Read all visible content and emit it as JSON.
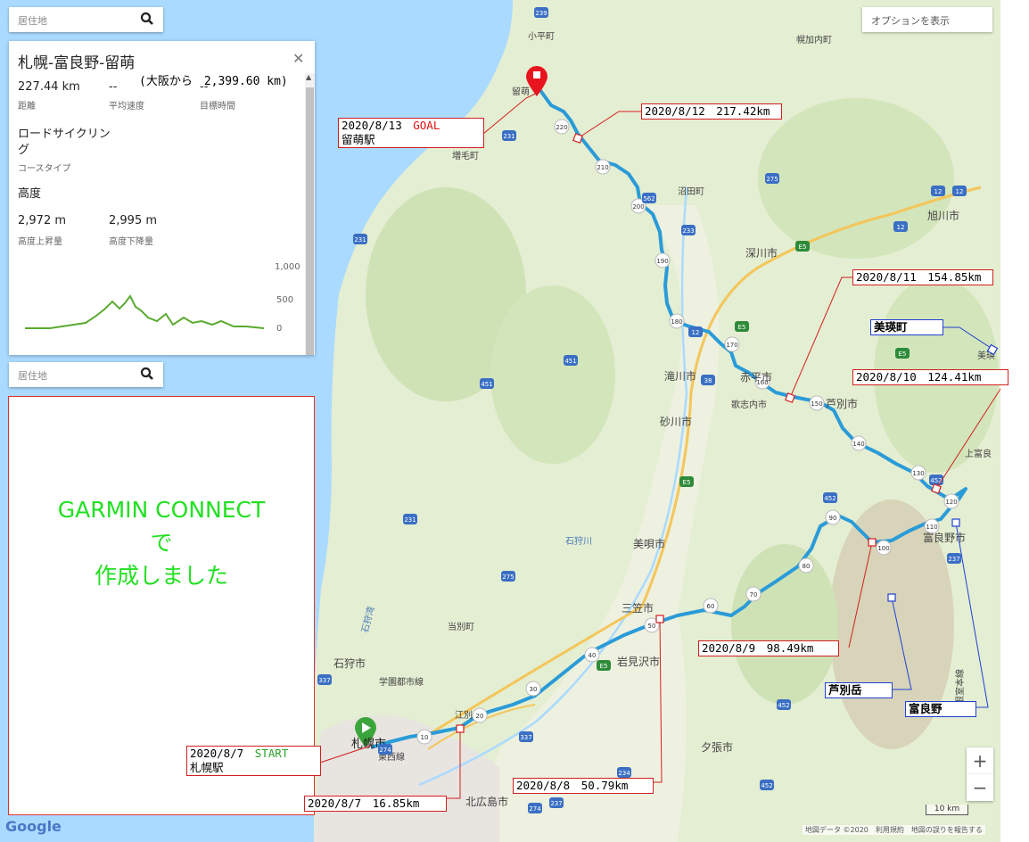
{
  "search": {
    "placeholder": "居住地"
  },
  "options_label": "オプションを表示",
  "course": {
    "title": "札幌-富良野-留萌",
    "osaka_note": "(大阪から　2,399.60 km)",
    "distance": "227.44 km",
    "distance_label": "距離",
    "avg_speed": "--",
    "avg_speed_label": "平均速度",
    "target_time": "--",
    "target_time_label": "目標時間",
    "course_type": "ロードサイクリング",
    "course_type_label": "コースタイプ",
    "elevation_heading": "高度",
    "ascent": "2,972 m",
    "ascent_label": "高度上昇量",
    "descent": "2,995 m",
    "descent_label": "高度下降量",
    "chart_ticks": [
      "1,000",
      "500",
      "0"
    ]
  },
  "garmin_note": [
    "GARMIN CONNECT",
    "で",
    "作成しました"
  ],
  "callouts": {
    "goal_date": "2020/8/13",
    "goal_tag": "GOAL",
    "goal_station": "留萌駅",
    "d0812": "2020/8/12　217.42km",
    "d0811": "2020/8/11　154.85km",
    "d0810": "2020/8/10　124.41km",
    "d0809": "2020/8/9　98.49km",
    "d0808": "2020/8/8　50.79km",
    "d0807": "2020/8/7　16.85km",
    "start_date": "2020/8/7",
    "start_tag": "START",
    "start_station": "札幌駅",
    "biei": "美瑛町",
    "ashibetsu": "芦別岳",
    "furano": "富良野"
  },
  "map_labels": {
    "obira": "小平町",
    "rumoi": "留萌",
    "mashike": "増毛町",
    "horokanai": "幌加内町",
    "numata": "沼田町",
    "asahikawa": "旭川市",
    "fukagawa": "深川市",
    "takikawa": "滝川市",
    "akabira": "赤平市",
    "utashinai": "歌志内市",
    "ashibetsu_city": "芦別市",
    "sunagawa": "砂川市",
    "kamifurano": "上富良",
    "furano_city": "富良野市",
    "bibai": "美唄市",
    "mikasa": "三笠市",
    "iwamizawa": "岩見沢市",
    "tobetsu": "当別町",
    "ishikari": "石狩市",
    "gakuen": "学園都市線",
    "ebetsu": "江別",
    "sapporo": "札幌市",
    "tosei": "東西線",
    "kitahiroshima": "北広島市",
    "yubari": "夕張市",
    "ishikarigawa": "石狩川",
    "ishikariwan": "石狩湾",
    "biei_small": "美瑛",
    "furano_line": "根室本線"
  },
  "route_kms": [
    "10",
    "20",
    "30",
    "40",
    "50",
    "60",
    "70",
    "80",
    "90",
    "100",
    "110",
    "120",
    "130",
    "140",
    "150",
    "160",
    "170",
    "180",
    "190",
    "200",
    "210",
    "220"
  ],
  "highway_labels": [
    "239",
    "231",
    "231",
    "231",
    "275",
    "233",
    "E5",
    "E5",
    "E5",
    "E5",
    "E5",
    "12",
    "12",
    "12",
    "452",
    "452",
    "452",
    "452",
    "451",
    "451",
    "275",
    "337",
    "337",
    "337",
    "274",
    "274",
    "234",
    "237",
    "237",
    "562",
    "38",
    "12"
  ],
  "zoom": {
    "in": "+",
    "out": "−"
  },
  "scale": "10 km",
  "attribution": "地図データ ©2020　利用規約　地図の誤りを報告する",
  "google": "Google",
  "colors": {
    "route": "#2a9bd8",
    "callout_red": "#d21f1f",
    "callout_blue": "#1f3fd2",
    "sea": "#aadaff",
    "land": "#e6efd5",
    "green": "#22e022"
  }
}
